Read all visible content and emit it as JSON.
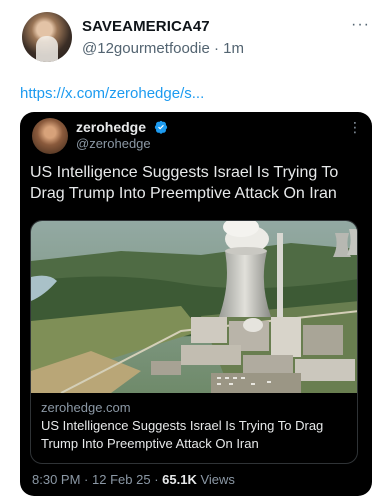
{
  "post": {
    "display_name": "SAVEAMERICA47",
    "handle": "@12gourmetfoodie",
    "separator": "·",
    "time": "1m",
    "more": "···",
    "link": "https://x.com/zerohedge/s..."
  },
  "quoted": {
    "name": "zerohedge",
    "handle": "@zerohedge",
    "verified": true,
    "text": "US Intelligence Suggests Israel Is Trying To Drag Trump Into Preemptive Attack On Iran",
    "preview": {
      "image_icon": "nuclear-plant-photo",
      "domain": "zerohedge.com",
      "title": "US Intelligence Suggests Israel Is Trying To Drag Trump Into Preemptive Attack On Iran"
    },
    "meta": {
      "time": "8:30 PM",
      "date": "12 Feb 25",
      "views_count": "65.1K",
      "views_label": "Views"
    }
  },
  "colors": {
    "link": "#1d9bf0",
    "card_bg": "#000000",
    "verified": "#1d9bf0"
  }
}
